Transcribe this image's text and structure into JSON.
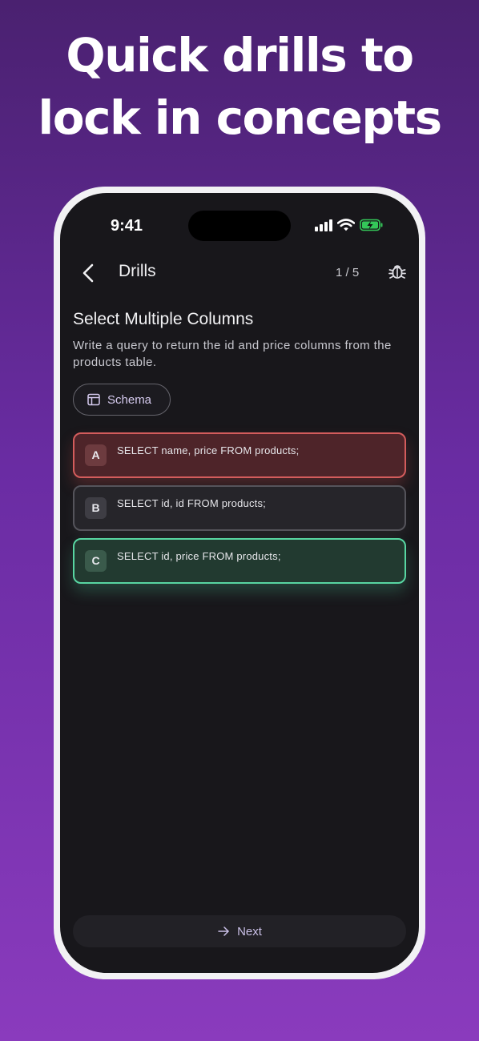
{
  "headline": {
    "line1": "Quick drills to",
    "line2": "lock in concepts"
  },
  "status_bar": {
    "time": "9:41",
    "icons": [
      "cellular-signal-icon",
      "wifi-icon",
      "battery-charging-icon"
    ],
    "battery_color": "#34c759"
  },
  "nav": {
    "back_icon": "chevron-left-icon",
    "title": "Drills",
    "counter": "1 / 5",
    "bug_icon": "bug-icon"
  },
  "question": {
    "title": "Select Multiple Columns",
    "description": "Write a query to return the id and price columns from the products table."
  },
  "schema_button": {
    "icon": "table-icon",
    "label": "Schema"
  },
  "options": [
    {
      "letter": "A",
      "text": "SELECT name, price FROM products;",
      "state": "incorrect"
    },
    {
      "letter": "B",
      "text": "SELECT id, id FROM products;",
      "state": "neutral"
    },
    {
      "letter": "C",
      "text": "SELECT id, price FROM products;",
      "state": "correct"
    }
  ],
  "next_button": {
    "icon": "arrow-right-icon",
    "label": "Next"
  },
  "colors": {
    "background_top": "#4a2170",
    "background_bottom": "#8a3bbd",
    "screen": "#18171b",
    "incorrect_border": "#d35c5c",
    "correct_border": "#58d6a2",
    "accent_text": "#d6cbef"
  }
}
